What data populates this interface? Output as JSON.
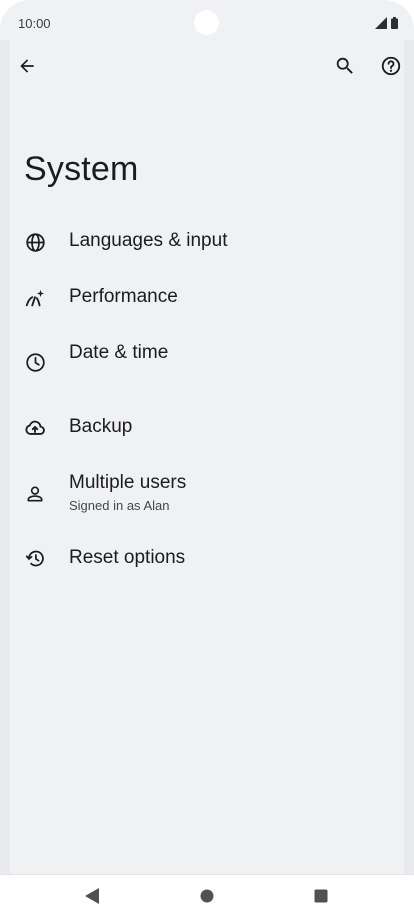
{
  "status_bar": {
    "time": "10:00",
    "icons": [
      "signal-icon",
      "battery-icon"
    ]
  },
  "top_bar": {
    "back_icon": "arrow-back-icon",
    "search_icon": "search-icon",
    "help_icon": "help-icon"
  },
  "page": {
    "title": "System"
  },
  "items": [
    {
      "label": "Languages & input",
      "icon": "globe-icon"
    },
    {
      "label": "Performance",
      "icon": "performance-icon"
    },
    {
      "label": "Date & time",
      "icon": "clock-icon"
    },
    {
      "label": "Backup",
      "icon": "cloud-upload-icon"
    },
    {
      "label": "Multiple users",
      "sublabel": "Signed in as Alan",
      "icon": "person-icon"
    },
    {
      "label": "Reset options",
      "icon": "history-icon"
    }
  ],
  "nav_bar": {
    "icons": [
      "nav-back-icon",
      "nav-home-icon",
      "nav-recents-icon"
    ]
  },
  "colors": {
    "background": "#f0f1f3",
    "text": "#1b1c1e",
    "secondary_text": "#45474a"
  }
}
